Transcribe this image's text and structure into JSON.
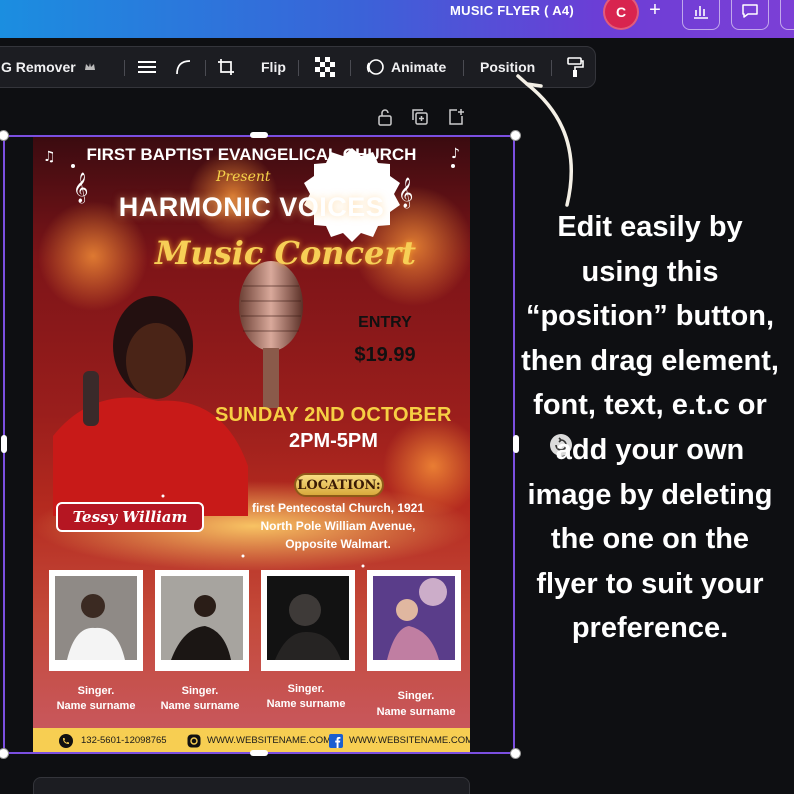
{
  "topbar": {
    "doc_title": "MUSIC FLYER ( A4)",
    "avatar_letter": "C",
    "add_symbol": "+"
  },
  "toolbar": {
    "bg_remover_label": "G Remover",
    "flip_label": "Flip",
    "animate_label": "Animate",
    "position_label": "Position"
  },
  "flyer": {
    "church": "FIRST BAPTIST EVANGELICAL CHURCH",
    "present": "Present",
    "event_title": "HARMONIC VOICES",
    "event_subtitle": "Music Concert",
    "entry_label": "ENTRY",
    "entry_price": "$19.99",
    "date": "SUNDAY 2ND OCTOBER",
    "time": "2PM-5PM",
    "location_label": "LOCATION:",
    "location_lines": [
      "first Pentecostal Church, 1921",
      "North Pole William Avenue,",
      "Opposite Walmart."
    ],
    "performer_name": "Tessy William",
    "singers": [
      {
        "role": "Singer.",
        "name": "Name surname"
      },
      {
        "role": "Singer.",
        "name": "Name surname"
      },
      {
        "role": "Singer.",
        "name": "Name surname"
      },
      {
        "role": "Singer.",
        "name": "Name surname"
      }
    ],
    "footer": {
      "phone": "132-5601-12098765",
      "instagram": "WWW.WEBSITENAME.COM",
      "facebook": "WWW.WEBSITENAME.COM"
    }
  },
  "annotation": "Edit easily by using this “position” button, then drag element, font, text, e.t.c or add your own image by deleting the one on the flyer to suit your preference.",
  "colors": {
    "selection": "#7b4fe0",
    "accent_gold": "#f6cf43",
    "avatar": "#d8244f"
  }
}
